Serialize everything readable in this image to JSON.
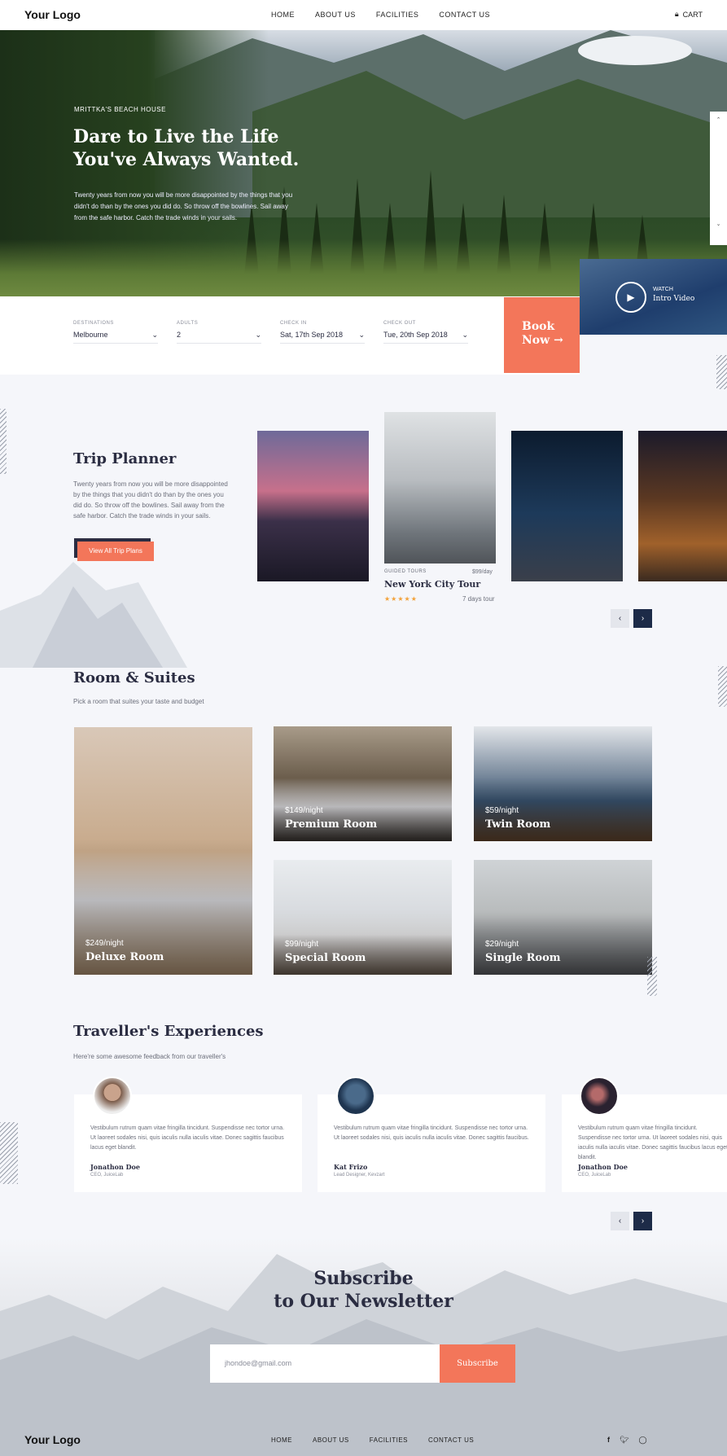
{
  "header": {
    "logo": "Your Logo",
    "nav": [
      "HOME",
      "ABOUT US",
      "FACILITIES",
      "CONTACT US"
    ],
    "cart": "CART",
    "cart_icon": "lock-icon"
  },
  "hero": {
    "kicker": "MRITTKA'S BEACH HOUSE",
    "title_line1": "Dare to Live the Life",
    "title_line2": "You've Always Wanted.",
    "text": "Twenty years from now you will be more disappointed by the things that you didn't do than by the ones you did do. So throw off the bowlines. Sail away from the safe harbor. Catch the trade winds in your sails."
  },
  "booking": {
    "fields": [
      {
        "label": "DESTINATIONS",
        "value": "Melbourne"
      },
      {
        "label": "ADULTS",
        "value": "2"
      },
      {
        "label": "CHECK IN",
        "value": "Sat, 17th Sep 2018"
      },
      {
        "label": "CHECK OUT",
        "value": "Tue, 20th Sep 2018"
      }
    ],
    "book_line1": "Book",
    "book_line2": "Now"
  },
  "video": {
    "watch": "WATCH",
    "label": "Intro Video"
  },
  "trip_planner": {
    "title": "Trip Planner",
    "text": "Twenty years from now you will be more disappointed by the things that you didn't do than by the ones you did do. So throw off the bowlines. Sail away from the safe harbor. Catch the trade winds in your sails.",
    "button": "View All Trip Plans",
    "featured": {
      "tag": "GUIDED TOURS",
      "price": "$99/day",
      "name": "New York City Tour",
      "stars": "★★★★★",
      "days": "7 days tour"
    }
  },
  "rooms": {
    "title": "Room & Suites",
    "subtitle": "Pick a room that suites your taste and budget",
    "items": [
      {
        "price": "$249/night",
        "name": "Deluxe Room"
      },
      {
        "price": "$149/night",
        "name": "Premium Room"
      },
      {
        "price": "$59/night",
        "name": "Twin Room"
      },
      {
        "price": "$99/night",
        "name": "Special Room"
      },
      {
        "price": "$29/night",
        "name": "Single Room"
      }
    ]
  },
  "experiences": {
    "title": "Traveller's Experiences",
    "subtitle": "Here're some awesome feedback from our traveller's",
    "items": [
      {
        "text": "Vestibulum rutrum quam vitae fringilla tincidunt. Suspendisse nec tortor urna. Ut laoreet sodales nisi, quis iaculis nulla iaculis vitae. Donec sagittis faucibus lacus eget blandit.",
        "name": "Jonathon Doe",
        "role": "CEO, JuiceLab"
      },
      {
        "text": "Vestibulum rutrum quam vitae fringilla tincidunt. Suspendisse nec tortor urna. Ut laoreet sodales nisi, quis iaculis nulla iaculis vitae. Donec sagittis faucibus.",
        "name": "Kat Frizo",
        "role": "Lead Designer, Kevzart"
      },
      {
        "text": "Vestibulum rutrum quam vitae fringilla tincidunt. Suspendisse nec tortor urna. Ut laoreet sodales nisi, quis iaculis nulla iaculis vitae. Donec sagittis faucibus lacus eget blandit.",
        "name": "Jonathon Doe",
        "role": "CEO, JuiceLab"
      }
    ]
  },
  "newsletter": {
    "title_line1": "Subscribe",
    "title_line2": "to Our Newsletter",
    "email_value": "jhondoe@gmail.com",
    "button": "Subscribe"
  },
  "footer": {
    "logo": "Your Logo",
    "nav": [
      "HOME",
      "ABOUT US",
      "FACILITIES",
      "CONTACT US"
    ],
    "social": [
      "facebook-icon",
      "twitter-icon",
      "instagram-icon"
    ]
  },
  "colors": {
    "accent": "#f3765a",
    "dark": "#1d2b48",
    "text": "#2b2d42",
    "background": "#f5f6fa"
  }
}
